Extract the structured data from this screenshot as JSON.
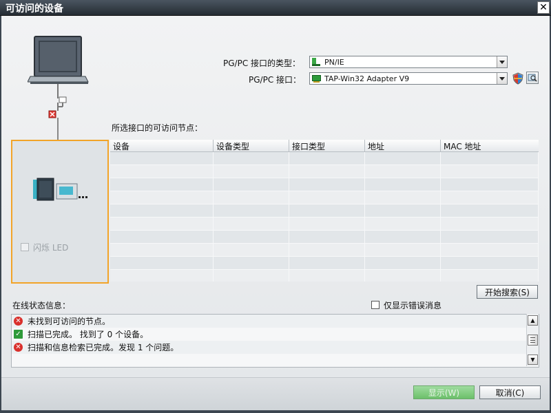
{
  "window": {
    "title": "可访问的设备",
    "close_label": "✕"
  },
  "interface_type": {
    "label": "PG/PC 接口的类型：",
    "value": "PN/IE"
  },
  "interface": {
    "label": "PG/PC 接口：",
    "value": "TAP-Win32 Adapter V9"
  },
  "nodes": {
    "label": "所选接口的可访问节点：",
    "columns": [
      "设备",
      "设备类型",
      "接口类型",
      "地址",
      "MAC 地址"
    ],
    "rows": 10
  },
  "flash_led": {
    "label": "闪烁 LED"
  },
  "search": {
    "button_label": "开始搜索(S)"
  },
  "status": {
    "label": "在线状态信息：",
    "only_errors_label": "仅显示错误消息",
    "messages": [
      {
        "type": "error",
        "text": "未找到可访问的节点。"
      },
      {
        "type": "ok",
        "text": "扫描已完成。 找到了 0 个设备。"
      },
      {
        "type": "error",
        "text": "扫描和信息检索已完成。发现 1 个问题。"
      }
    ]
  },
  "footer": {
    "show_label": "显示(W)",
    "cancel_label": "取消(C)"
  },
  "colors": {
    "highlight_border": "#f2a428",
    "error": "#d9302c",
    "ok": "#2f9a3a",
    "show_button": "#78c676"
  },
  "icons": [
    "close-icon",
    "pc-icon",
    "network-card-icon",
    "shield-icon",
    "scan-icon",
    "disconnected-icon",
    "plc-device-icon",
    "error-icon",
    "check-icon",
    "chevron-up-icon",
    "chevron-down-icon"
  ]
}
